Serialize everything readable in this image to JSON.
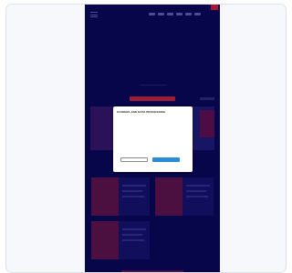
{
  "screen": {
    "site_name": "",
    "section_heading": "",
    "faint_text": ""
  },
  "cookie_dialog": {
    "title": "COOKIES AND DATA PROCESSING",
    "body": "",
    "settings_link": "",
    "options": [
      "",
      "",
      "",
      ""
    ],
    "decline_label": "",
    "accept_label": "",
    "footer_link": ""
  },
  "colors": {
    "page_background": "#0a0855",
    "brand_accent": "#b5223f",
    "primary_button": "#2a8cd8"
  }
}
